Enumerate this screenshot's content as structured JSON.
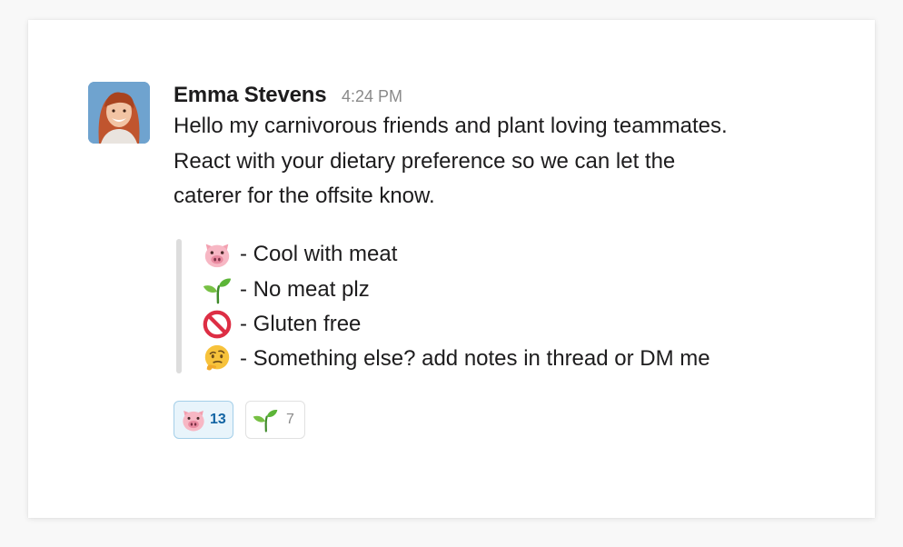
{
  "message": {
    "author": "Emma Stevens",
    "timestamp": "4:24 PM",
    "lines": [
      "Hello my carnivorous friends and plant loving teammates.",
      "React with your dietary preference so we can let the",
      "caterer for the offsite know."
    ],
    "options": [
      {
        "icon": "pig-face-icon",
        "text": "- Cool with meat"
      },
      {
        "icon": "seedling-icon",
        "text": "- No meat plz"
      },
      {
        "icon": "prohibited-icon",
        "text": "- Gluten free"
      },
      {
        "icon": "thinking-face-icon",
        "text": "- Something else? add notes in thread or DM me"
      }
    ]
  },
  "reactions": [
    {
      "icon": "pig-face-icon",
      "count": "13",
      "reacted_by_me": true
    },
    {
      "icon": "seedling-icon",
      "count": "7",
      "reacted_by_me": false
    }
  ],
  "colors": {
    "reaction_active_bg": "#e8f4fb",
    "reaction_active_border": "#a4cfe9",
    "reaction_active_count": "#1264a3",
    "timestamp": "#8a8a8a"
  }
}
